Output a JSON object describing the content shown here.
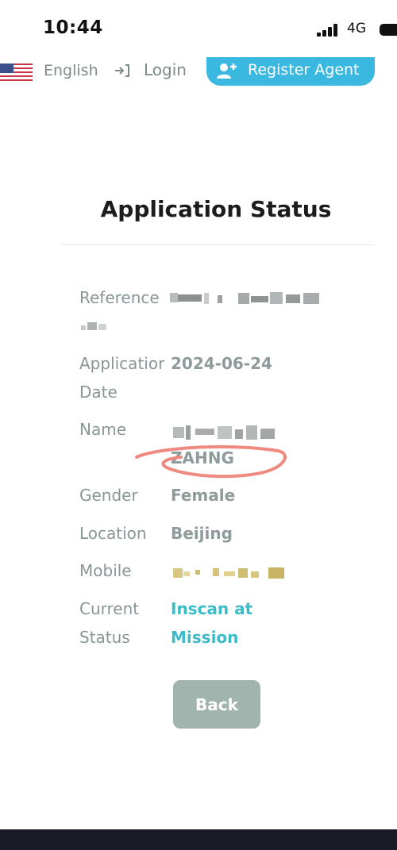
{
  "status_bar": {
    "time": "10:44",
    "network": "4G"
  },
  "nav": {
    "language": "English",
    "login": "Login",
    "register": "Register Agent"
  },
  "page": {
    "title": "Application Status"
  },
  "fields": {
    "reference_label": "Reference",
    "date_label_1": "Applicatior",
    "date_label_2": "Date",
    "date_value": "2024-06-24",
    "name_label": "Name",
    "name_value": "ZAHNG",
    "gender_label": "Gender",
    "gender_value": "Female",
    "location_label": "Location",
    "location_value": "Beijing",
    "mobile_label": "Mobile",
    "status_label_1": "Current",
    "status_label_2": "Status",
    "status_value_1": "Inscan at",
    "status_value_2": "Mission"
  },
  "actions": {
    "back": "Back"
  },
  "colors": {
    "accent": "#3cbcc8",
    "register_button": "#3ab8e0",
    "back_button": "#a1b5ae",
    "annotation": "#ef8a80"
  },
  "icons": [
    "us-flag-icon",
    "login-icon",
    "add-user-icon",
    "signal-icon",
    "battery-icon"
  ]
}
